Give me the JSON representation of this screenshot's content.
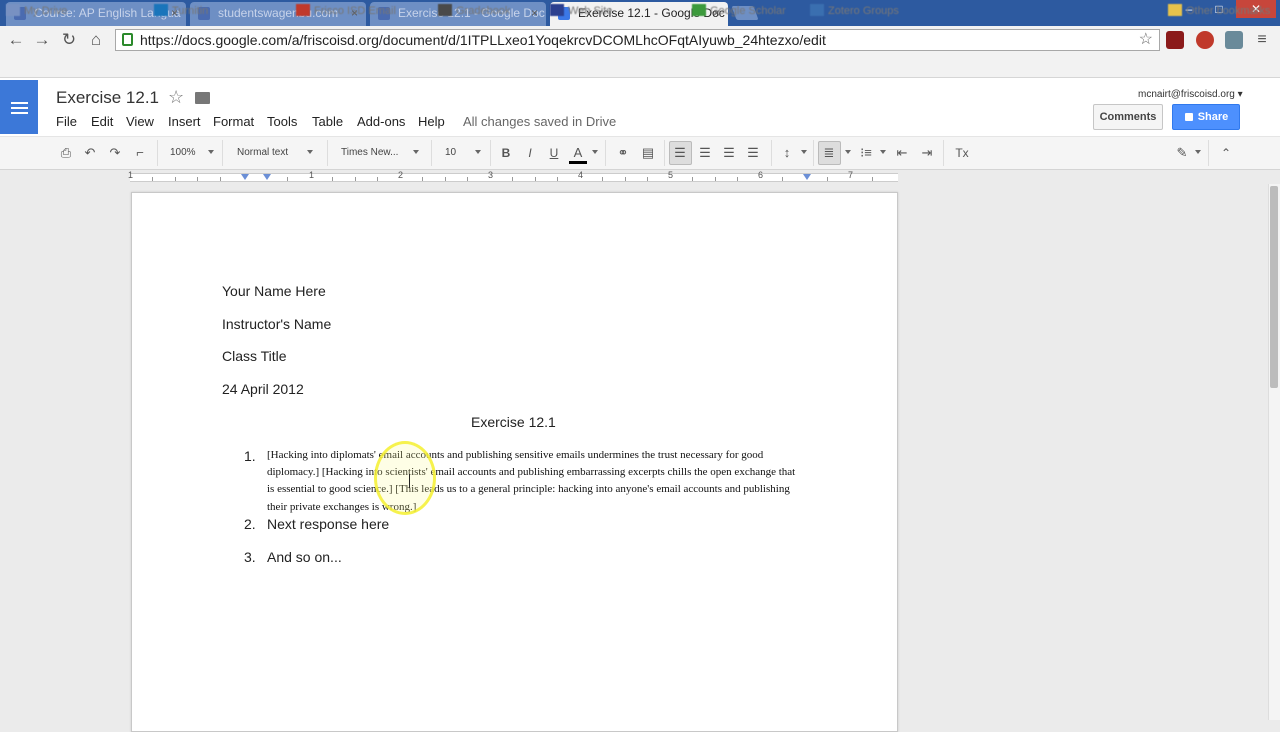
{
  "browser": {
    "tabs": [
      {
        "title": "Course: AP English Langua",
        "active": false
      },
      {
        "title": "studentswagenbu.com",
        "active": false
      },
      {
        "title": "Exercise 12.1 - Google Doc",
        "active": false
      },
      {
        "title": "Exercise 12.1 - Google Doc",
        "active": true
      }
    ],
    "tab_close": "×",
    "url": "https://docs.google.com/a/friscoisd.org/document/d/1ITPLLxeo1YoqekrcvDCOMLhcOFqtAIyuwb_24htezxo/edit",
    "bookmarks": [
      "My Drive",
      "Turnitin",
      "Frisco ISD Email",
      "Gradebook",
      "Web Site",
      "Google Scholar",
      "Zotero Groups",
      "Other bookmarks"
    ],
    "window_controls": {
      "minimize": "–",
      "maximize": "□",
      "close": "✕"
    }
  },
  "docs": {
    "title": "Exercise 12.1",
    "menu": [
      "File",
      "Edit",
      "View",
      "Insert",
      "Format",
      "Tools",
      "Table",
      "Add-ons",
      "Help"
    ],
    "saved_status": "All changes saved in Drive",
    "account": "mcnairt@friscoisd.org",
    "comments_label": "Comments",
    "share_label": "Share",
    "toolbar": {
      "zoom": "100%",
      "style": "Normal text",
      "font": "Times New...",
      "size": "10",
      "bold": "B",
      "italic": "I",
      "underline": "U",
      "text_color": "A",
      "clear_formatting": "Tx"
    },
    "ruler_numbers": [
      "1",
      "1",
      "2",
      "3",
      "4",
      "5",
      "6",
      "7"
    ]
  },
  "document": {
    "header_lines": [
      "Your Name Here",
      "Instructor's Name",
      "Class Title",
      "24 April 2012"
    ],
    "heading": "Exercise 12.1",
    "list": [
      {
        "number": "1.",
        "text": "[Hacking into diplomats' email accounts and publishing sensitive emails undermines the trust necessary for good diplomacy.] [Hacking into scientists' email accounts and publishing embarrassing excerpts chills the open exchange that is essential to good science.] [This leads us to a general principle: hacking into anyone's email accounts and publishing their private exchanges is wrong.]"
      },
      {
        "number": "2.",
        "text": "Next response here"
      },
      {
        "number": "3.",
        "text": "And so on..."
      }
    ]
  },
  "colors": {
    "tabbar": "#2d5aa0",
    "docs_blue": "#3c78d8",
    "share_blue": "#4d90fe",
    "cursor_highlight": "#f5f032"
  },
  "icons": [
    "back-icon",
    "forward-icon",
    "reload-icon",
    "home-icon",
    "lock-icon",
    "bookmark-star-icon",
    "docs-logo-icon",
    "star-icon",
    "folder-icon",
    "print-icon",
    "undo-icon",
    "redo-icon",
    "paint-format-icon",
    "link-icon",
    "comment-icon",
    "align-left-icon",
    "align-center-icon",
    "align-right-icon",
    "justify-icon",
    "line-spacing-icon",
    "numbered-list-icon",
    "bulleted-list-icon",
    "decrease-indent-icon",
    "increase-indent-icon",
    "pencil-icon",
    "collapse-icon"
  ]
}
